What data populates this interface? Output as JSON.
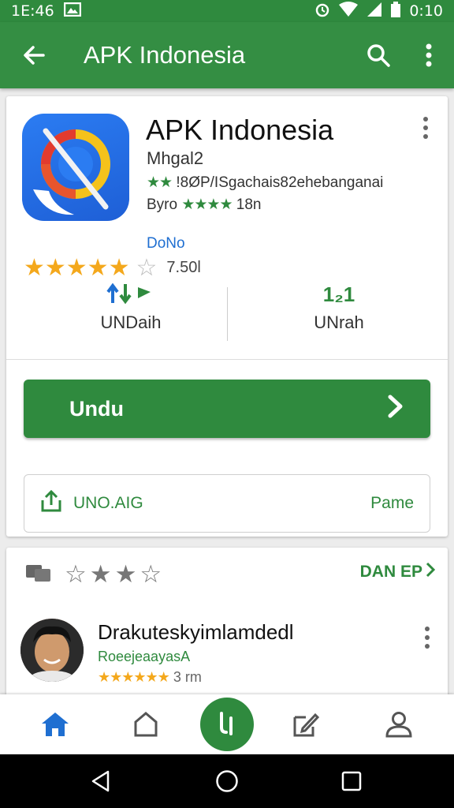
{
  "status_bar": {
    "time_left": "1E:46",
    "time_right": "0:10",
    "icons": [
      "gallery-icon",
      "alarm-icon",
      "wifi-icon",
      "signal-icon",
      "battery-icon"
    ]
  },
  "app_bar": {
    "title": "APK Indonesia",
    "icons": [
      "back-arrow-icon",
      "search-icon",
      "more-vert-icon"
    ]
  },
  "app": {
    "name": "APK Indonesia",
    "developer": "Mhgal2",
    "line1_stars": "★★",
    "line1_text": "!8ØP/ISgachais82ehebanganai",
    "line2_prefix": "Byro",
    "line2_stars": "★★★★",
    "line2_suffix": "18n",
    "badge": "DoNo",
    "rating_stars": "★★★★★",
    "rating_empty_star": "☆",
    "rating_value": "7.50l"
  },
  "stats": [
    {
      "icon_text": "⇅▸",
      "label": "UNDaih"
    },
    {
      "icon_text": "1₂1",
      "label": "UNrah"
    }
  ],
  "actions": {
    "primary_label": "Undu",
    "secondary_label": "UNO.AIG",
    "secondary_right": "Pame"
  },
  "reviews": {
    "head_stars": "☆★★☆",
    "more_label": "DAN EP",
    "reviewer_name": "Drakuteskyimlamdedl",
    "reviewer_sub": "RoeejeaayasA",
    "review_stars": "★★★★★★",
    "review_time": "3 rm"
  },
  "bottom_nav": {
    "items": [
      "home-icon",
      "store-icon",
      "fab-icon",
      "edit-icon",
      "profile-icon"
    ]
  },
  "colors": {
    "primary": "#2f8a3e",
    "star": "#f4a81c",
    "link": "#1f6fd1"
  }
}
